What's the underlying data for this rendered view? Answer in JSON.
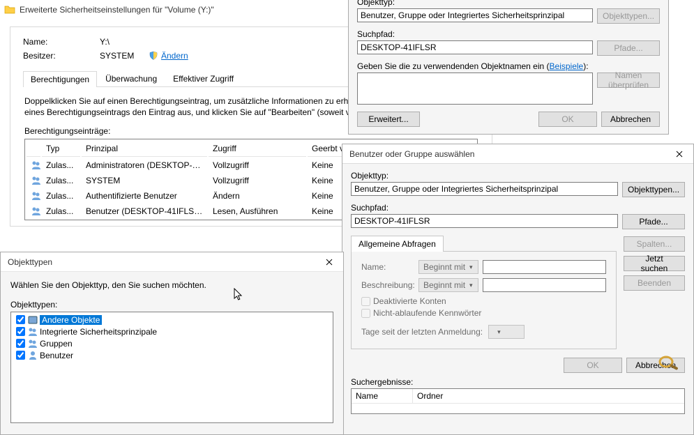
{
  "advsec": {
    "title": "Erweiterte Sicherheitseinstellungen für \"Volume (Y:)\"",
    "name_lbl": "Name:",
    "name_val": "Y:\\",
    "owner_lbl": "Besitzer:",
    "owner_val": "SYSTEM",
    "change_link": "Ändern",
    "tabs": {
      "perm": "Berechtigungen",
      "audit": "Überwachung",
      "eff": "Effektiver Zugriff"
    },
    "hint": "Doppelklicken Sie auf einen Berechtigungseintrag, um zusätzliche Informationen zu erhalten. Wählen Sie zum Ändern eines Berechtigungseintrags den Eintrag aus, und klicken Sie auf \"Bearbeiten\" (soweit vorhanden).",
    "entries_lbl": "Berechtigungseinträge:",
    "cols": {
      "type": "Typ",
      "principal": "Prinzipal",
      "access": "Zugriff",
      "inherit": "Geerbt von"
    },
    "rows": [
      {
        "type": "Zulas...",
        "principal": "Administratoren (DESKTOP-4...",
        "access": "Vollzugriff",
        "inherit": "Keine"
      },
      {
        "type": "Zulas...",
        "principal": "SYSTEM",
        "access": "Vollzugriff",
        "inherit": "Keine"
      },
      {
        "type": "Zulas...",
        "principal": "Authentifizierte Benutzer",
        "access": "Ändern",
        "inherit": "Keine"
      },
      {
        "type": "Zulas...",
        "principal": "Benutzer (DESKTOP-41IFLSR\\...",
        "access": "Lesen, Ausführen",
        "inherit": "Keine"
      }
    ]
  },
  "selobj_top": {
    "objtype_lbl": "Objekttyp:",
    "objtype_val": "Benutzer, Gruppe oder Integriertes Sicherheitsprinzipal",
    "objtypes_btn": "Objekttypen...",
    "path_lbl": "Suchpfad:",
    "path_val": "DESKTOP-41IFLSR",
    "paths_btn": "Pfade...",
    "names_prompt": "Geben Sie die zu verwendenden Objektnamen ein",
    "examples_link": "Beispiele",
    "checknames_btn": "Namen überprüfen",
    "adv_btn": "Erweitert...",
    "ok": "OK",
    "cancel": "Abbrechen"
  },
  "objtypes": {
    "title": "Objekttypen",
    "prompt": "Wählen Sie den Objekttyp, den Sie suchen möchten.",
    "list_lbl": "Objekttypen:",
    "items": {
      "other": "Andere Objekte",
      "builtin": "Integrierte Sicherheitsprinzipale",
      "groups": "Gruppen",
      "users": "Benutzer"
    }
  },
  "selobj_adv": {
    "title": "Benutzer oder Gruppe auswählen",
    "objtype_lbl": "Objekttyp:",
    "objtype_val": "Benutzer, Gruppe oder Integriertes Sicherheitsprinzipal",
    "objtypes_btn": "Objekttypen...",
    "path_lbl": "Suchpfad:",
    "path_val": "DESKTOP-41IFLSR",
    "paths_btn": "Pfade...",
    "tab_common": "Allgemeine Abfragen",
    "name_lbl": "Name:",
    "desc_lbl": "Beschreibung:",
    "begins": "Beginnt mit",
    "chk_disabled": "Deaktivierte Konten",
    "chk_nonexp": "Nicht-ablaufende Kennwörter",
    "days_lbl": "Tage seit der letzten Anmeldung:",
    "cols_btn": "Spalten...",
    "search_btn": "Jetzt suchen",
    "stop_btn": "Beenden",
    "ok": "OK",
    "cancel": "Abbrechen",
    "results_lbl": "Suchergebnisse:",
    "col_name": "Name",
    "col_folder": "Ordner"
  }
}
